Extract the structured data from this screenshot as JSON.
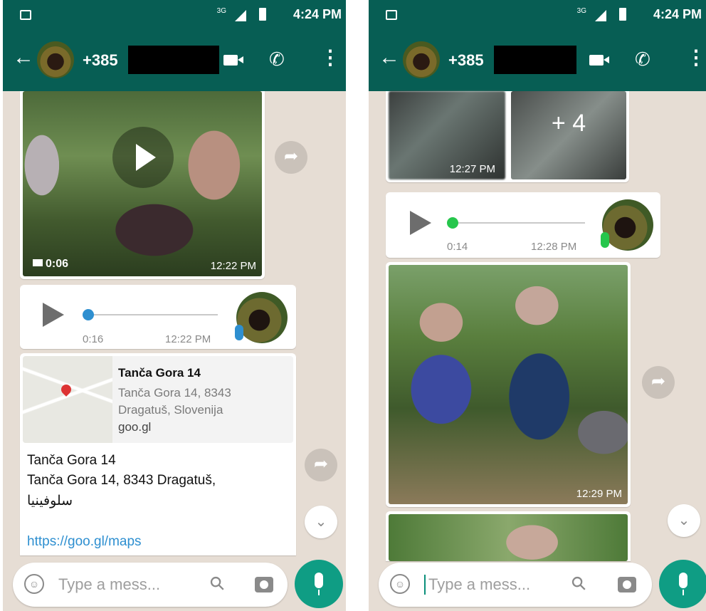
{
  "colors": {
    "header": "#075e54",
    "accent": "#4fc3a1",
    "fab": "#0f9d84",
    "link": "#2e8fd0",
    "mic_blue": "#2e8fd0"
  },
  "status_bar": {
    "network": "3G",
    "time": "4:24 PM"
  },
  "chat_header": {
    "back_icon": "arrow-left-icon",
    "contact_number_prefix": "+385"
  },
  "left_screen": {
    "video_message": {
      "duration": "0:06",
      "time": "12:22 PM"
    },
    "voice_message": {
      "duration": "0:16",
      "time": "12:22 PM",
      "progress": 0.0
    },
    "location_message": {
      "card_title": "Tanča Gora 14",
      "card_address": "Tanča Gora 14, 8343 Dragatuš, Slovenija",
      "card_link": "goo.gl",
      "text_line1": "Tanča Gora 14",
      "text_line2": "Tanča Gora 14, 8343 Dragatuš,",
      "text_line3": "سلوفينيا",
      "url": "https://goo.gl/maps"
    },
    "composer": {
      "placeholder": "Type a mess..."
    }
  },
  "right_screen": {
    "image_grid": {
      "time": "12:27 PM",
      "more_count": "+ 4"
    },
    "voice_message": {
      "duration": "0:14",
      "time": "12:28 PM",
      "progress": 0.0
    },
    "photo_message": {
      "time": "12:29 PM"
    },
    "composer": {
      "placeholder": "Type a mess..."
    }
  }
}
